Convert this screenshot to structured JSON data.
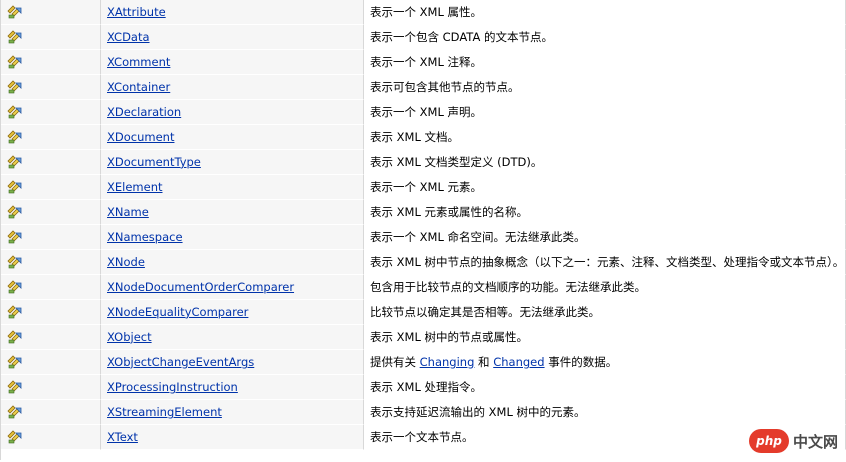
{
  "rows": [
    {
      "name": "XAttribute",
      "desc": "表示一个 XML 属性。"
    },
    {
      "name": "XCData",
      "desc": "表示一个包含 CDATA 的文本节点。"
    },
    {
      "name": "XComment",
      "desc": "表示一个 XML 注释。"
    },
    {
      "name": "XContainer",
      "desc": "表示可包含其他节点的节点。"
    },
    {
      "name": "XDeclaration",
      "desc": "表示一个 XML 声明。"
    },
    {
      "name": "XDocument",
      "desc": "表示 XML 文档。"
    },
    {
      "name": "XDocumentType",
      "desc": "表示 XML 文档类型定义 (DTD)。"
    },
    {
      "name": "XElement",
      "desc": "表示一个 XML 元素。"
    },
    {
      "name": "XName",
      "desc": "表示 XML 元素或属性的名称。"
    },
    {
      "name": "XNamespace",
      "desc": "表示一个 XML 命名空间。无法继承此类。"
    },
    {
      "name": "XNode",
      "desc": "表示 XML 树中节点的抽象概念（以下之一：元素、注释、文档类型、处理指令或文本节点）。"
    },
    {
      "name": "XNodeDocumentOrderComparer",
      "desc": "包含用于比较节点的文档顺序的功能。无法继承此类。"
    },
    {
      "name": "XNodeEqualityComparer",
      "desc": "比较节点以确定其是否相等。无法继承此类。"
    },
    {
      "name": "XObject",
      "desc": "表示 XML 树中的节点或属性。"
    },
    {
      "name": "XObjectChangeEventArgs",
      "desc_parts": {
        "pre": "提供有关 ",
        "link1": "Changing",
        "mid": " 和 ",
        "link2": "Changed",
        "post": " 事件的数据。"
      }
    },
    {
      "name": "XProcessingInstruction",
      "desc": "表示 XML 处理指令。"
    },
    {
      "name": "XStreamingElement",
      "desc": "表示支持延迟流输出的 XML 树中的元素。"
    },
    {
      "name": "XText",
      "desc": "表示一个文本节点。"
    }
  ],
  "watermark": {
    "logo": "php",
    "text": "中文网"
  },
  "icon_name": "class-icon"
}
